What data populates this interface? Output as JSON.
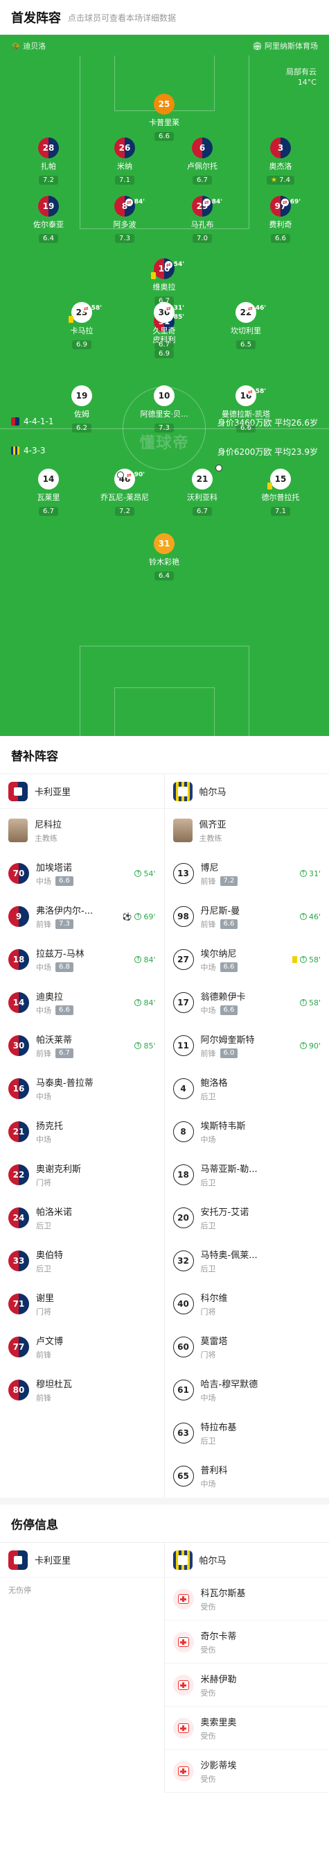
{
  "header": {
    "title": "首发阵容",
    "subtitle": "点击球员可查看本场详细数据"
  },
  "pitch": {
    "home_team": "迪贝洛",
    "venue": "阿里纳斯体育场",
    "weather": "局部有云",
    "temp": "14°C",
    "watermark": "懂球帝",
    "home_form": {
      "formation": "4-4-1-1",
      "value": "身价3460万欧",
      "age": "平均26.6岁"
    },
    "away_form": {
      "formation": "4-3-3",
      "value": "身价6200万欧",
      "age": "平均23.9岁"
    },
    "players": [
      {
        "num": "25",
        "name": "卡普里莱",
        "rating": "6.6",
        "side": "gk1"
      },
      {
        "num": "28",
        "name": "扎帕",
        "rating": "7.2",
        "side": "home"
      },
      {
        "num": "26",
        "name": "米纳",
        "rating": "7.1",
        "side": "home"
      },
      {
        "num": "6",
        "name": "卢佩尔托",
        "rating": "6.7",
        "side": "home"
      },
      {
        "num": "3",
        "name": "奥杰洛",
        "rating": "7.4",
        "side": "home",
        "star": true
      },
      {
        "num": "19",
        "name": "佐尔泰亚",
        "rating": "6.4",
        "side": "home"
      },
      {
        "num": "8",
        "name": "阿多波",
        "rating": "7.3",
        "side": "home",
        "sub": "84'"
      },
      {
        "num": "29",
        "name": "马孔布",
        "rating": "7.0",
        "side": "home",
        "sub": "84'"
      },
      {
        "num": "97",
        "name": "费利奇",
        "rating": "6.6",
        "side": "home",
        "sub": "69'"
      },
      {
        "num": "10",
        "name": "维奥拉",
        "rating": "6.7",
        "side": "home",
        "sub": "54'",
        "yc": true
      },
      {
        "num": "91",
        "name": "皮科利",
        "rating": "6.9",
        "side": "home",
        "sub": "85'"
      },
      {
        "num": "23",
        "name": "卡马拉",
        "rating": "6.9",
        "side": "away",
        "sub": "58'",
        "yc": true
      },
      {
        "num": "30",
        "name": "久里奇",
        "rating": "6.7",
        "side": "away",
        "sub": "31'"
      },
      {
        "num": "22",
        "name": "坎切利里",
        "rating": "6.5",
        "side": "away",
        "sub": "46'"
      },
      {
        "num": "19",
        "name": "佐姆",
        "rating": "6.2",
        "side": "away"
      },
      {
        "num": "10",
        "name": "阿德里安·贝...",
        "rating": "7.3",
        "side": "away"
      },
      {
        "num": "16",
        "name": "曼德拉斯-凯塔",
        "rating": "6.6",
        "side": "away",
        "sub": "58'"
      },
      {
        "num": "14",
        "name": "瓦莱里",
        "rating": "6.7",
        "side": "away"
      },
      {
        "num": "46",
        "name": "乔瓦尼-莱昂尼",
        "rating": "7.2",
        "side": "away",
        "sub": "90'",
        "ball": true
      },
      {
        "num": "21",
        "name": "沃利亚科",
        "rating": "6.7",
        "side": "away",
        "ball": true
      },
      {
        "num": "15",
        "name": "德尔普拉托",
        "rating": "7.1",
        "side": "away",
        "yc": true
      },
      {
        "num": "31",
        "name": "铃木彩艳",
        "rating": "6.4",
        "side": "gk2"
      }
    ]
  },
  "subs": {
    "title": "替补阵容",
    "home_team": "卡利亚里",
    "away_team": "帕尔马",
    "home_coach": {
      "name": "尼科拉",
      "role": "主教练"
    },
    "away_coach": {
      "name": "佩齐亚",
      "role": "主教练"
    },
    "home": [
      {
        "num": "70",
        "name": "加埃塔诺",
        "pos": "中场",
        "rating": "6.6",
        "in": "54'"
      },
      {
        "num": "9",
        "name": "弗洛伊内尔-...",
        "pos": "前锋",
        "rating": "7.3",
        "in": "69'",
        "goal": true
      },
      {
        "num": "18",
        "name": "拉兹万-马林",
        "pos": "中场",
        "rating": "6.8",
        "in": "84'"
      },
      {
        "num": "14",
        "name": "迪奥拉",
        "pos": "中场",
        "rating": "6.6",
        "in": "84'"
      },
      {
        "num": "30",
        "name": "帕沃莱蒂",
        "pos": "前锋",
        "rating": "6.7",
        "in": "85'"
      },
      {
        "num": "16",
        "name": "马泰奥-普拉蒂",
        "pos": "中场"
      },
      {
        "num": "21",
        "name": "扬克托",
        "pos": "中场"
      },
      {
        "num": "22",
        "name": "奥谢克利斯",
        "pos": "门将"
      },
      {
        "num": "24",
        "name": "帕洛米诺",
        "pos": "后卫"
      },
      {
        "num": "33",
        "name": "奥伯特",
        "pos": "后卫"
      },
      {
        "num": "71",
        "name": "谢里",
        "pos": "门将"
      },
      {
        "num": "77",
        "name": "卢文博",
        "pos": "前锋"
      },
      {
        "num": "80",
        "name": "穆坦杜瓦",
        "pos": "前锋"
      }
    ],
    "away": [
      {
        "num": "13",
        "name": "博尼",
        "pos": "前锋",
        "rating": "7.2",
        "in": "31'"
      },
      {
        "num": "98",
        "name": "丹尼斯-曼",
        "pos": "前锋",
        "rating": "6.6",
        "in": "46'"
      },
      {
        "num": "27",
        "name": "埃尔纳尼",
        "pos": "中场",
        "rating": "6.6",
        "in": "58'",
        "yc": true
      },
      {
        "num": "17",
        "name": "翁德赖伊卡",
        "pos": "中场",
        "rating": "6.6",
        "in": "58'"
      },
      {
        "num": "11",
        "name": "阿尔姆奎斯特",
        "pos": "前锋",
        "rating": "6.0",
        "in": "90'"
      },
      {
        "num": "4",
        "name": "鲍洛格",
        "pos": "后卫"
      },
      {
        "num": "8",
        "name": "埃斯特韦斯",
        "pos": "中场"
      },
      {
        "num": "18",
        "name": "马蒂亚斯-勒...",
        "pos": "后卫"
      },
      {
        "num": "20",
        "name": "安托万-艾诺",
        "pos": "后卫"
      },
      {
        "num": "32",
        "name": "马特奥-佩莱...",
        "pos": "后卫"
      },
      {
        "num": "40",
        "name": "科尔维",
        "pos": "门将"
      },
      {
        "num": "60",
        "name": "莫雷塔",
        "pos": "门将"
      },
      {
        "num": "61",
        "name": "哈吉-穆罕默德",
        "pos": "中场"
      },
      {
        "num": "63",
        "name": "特拉布基",
        "pos": "后卫"
      },
      {
        "num": "65",
        "name": "普利科",
        "pos": "中场"
      }
    ]
  },
  "injuries": {
    "title": "伤停信息",
    "home_team": "卡利亚里",
    "away_team": "帕尔马",
    "none": "无伤停",
    "away": [
      {
        "name": "科瓦尔斯基",
        "status": "受伤"
      },
      {
        "name": "奇尔卡蒂",
        "status": "受伤"
      },
      {
        "name": "米赫伊勒",
        "status": "受伤"
      },
      {
        "name": "奥索里奥",
        "status": "受伤"
      },
      {
        "name": "沙影蒂埃",
        "status": "受伤"
      }
    ]
  }
}
